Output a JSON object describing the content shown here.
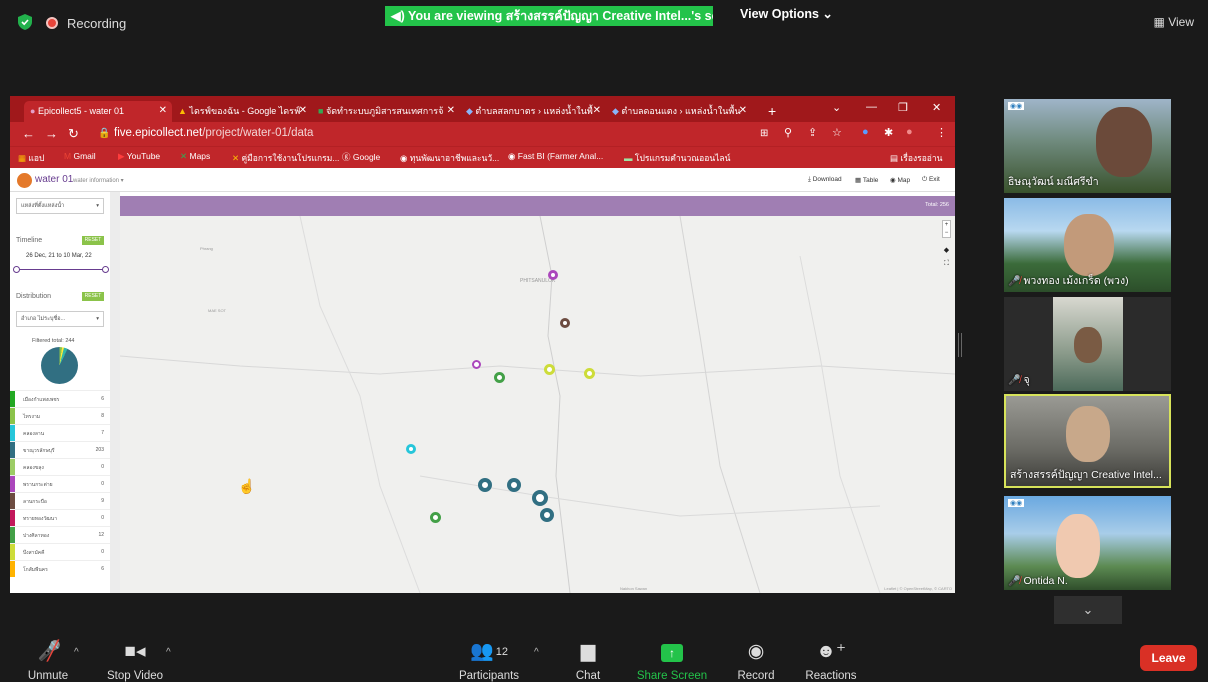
{
  "zoom": {
    "recording_label": "Recording",
    "share_banner": "You are viewing สร้างสรรค์ปัญญา Creative Intel...'s screen",
    "view_options": "View Options ⌄",
    "view_label": "View"
  },
  "browser": {
    "tabs": [
      {
        "label": "Epicollect5 - water 01"
      },
      {
        "label": "ไดรฟ์ของฉัน - Google ไดรฟ์"
      },
      {
        "label": "จัดทำระบบภูมิสารสนเทศการจ้"
      },
      {
        "label": "ตำบลสลกบาตร › แหล่งน้ำในพื้"
      },
      {
        "label": "ตำบลดอนแตง › แหล่งน้ำในพื้น"
      }
    ],
    "new_tab": "+",
    "url_host": "five.epicollect.net",
    "url_path": "/project/water-01/data",
    "bookmarks": [
      {
        "label": "แอป"
      },
      {
        "label": "Gmail"
      },
      {
        "label": "YouTube"
      },
      {
        "label": "Maps"
      },
      {
        "label": "คู่มือการใช้งานโปรแกรม..."
      },
      {
        "label": "Google"
      },
      {
        "label": "ทุนพัฒนาอาชีพและนวั..."
      },
      {
        "label": "Fast BI (Farmer Anal..."
      },
      {
        "label": "โปรแกรมคำนวณออนไลน์"
      }
    ],
    "reading_list": "เรื่องรออ่าน"
  },
  "app": {
    "project_name": "water 01",
    "project_sub": "water information ▾",
    "actions": {
      "download": "Download",
      "table": "Table",
      "map": "Map",
      "exit": "Exit"
    },
    "total_label": "Total: 256",
    "sidebar": {
      "form_select": "แหล่งที่ตั้งแหล่งน้ำ",
      "timeline_label": "Timeline",
      "reset_label": "RESET",
      "date_range": "26 Dec, 21 to 10 Mar, 22",
      "distribution_label": "Distribution",
      "dist_select": "อำเภอ ไม่ระบุชื่อ...",
      "filtered_label": "Filtered total: 244",
      "legend": [
        {
          "name": "เมืองกำแพงเพชร",
          "value": "6",
          "color": "#22a822"
        },
        {
          "name": "ไทรงาม",
          "value": "8",
          "color": "#8bc34a"
        },
        {
          "name": "คลองลาน",
          "value": "7",
          "color": "#26c6da"
        },
        {
          "name": "ขาณุวรลักษบุรี",
          "value": "203",
          "color": "#316f82"
        },
        {
          "name": "คลองขลุง",
          "value": "0",
          "color": "#9ccc65"
        },
        {
          "name": "พรานกระต่าย",
          "value": "0",
          "color": "#ab47bc"
        },
        {
          "name": "ลานกระบือ",
          "value": "9",
          "color": "#6d4c41"
        },
        {
          "name": "ทรายทองวัฒนา",
          "value": "0",
          "color": "#c2185b"
        },
        {
          "name": "ปางศิลาทอง",
          "value": "12",
          "color": "#43a047"
        },
        {
          "name": "บึงสามัคคี",
          "value": "0",
          "color": "#cddc39"
        },
        {
          "name": "โกสัมพีนคร",
          "value": "6",
          "color": "#ffb300"
        }
      ]
    },
    "map": {
      "places": [
        {
          "name": "PHITSANULOK"
        },
        {
          "name": "MAE SOT"
        },
        {
          "name": "Phrang"
        },
        {
          "name": "Nakhon Sawan"
        }
      ],
      "attribution": "Leaflet | © OpenStreetMap, © CARTO"
    }
  },
  "participants": [
    {
      "name": "ธิษณุวัฒน์ มณีศรีขำ",
      "muted": false
    },
    {
      "name": "พวงทอง เม้งเกร็ด (พวง)",
      "muted": true
    },
    {
      "name": "จุ",
      "muted": true
    },
    {
      "name": "สร้างสรรค์ปัญญา Creative Intel...",
      "muted": false
    },
    {
      "name": "Ontida N.",
      "muted": true
    }
  ],
  "toolbar": {
    "unmute": "Unmute",
    "stop_video": "Stop Video",
    "participants": "Participants",
    "participants_count": "12",
    "chat": "Chat",
    "share_screen": "Share Screen",
    "record": "Record",
    "reactions": "Reactions",
    "leave": "Leave"
  }
}
